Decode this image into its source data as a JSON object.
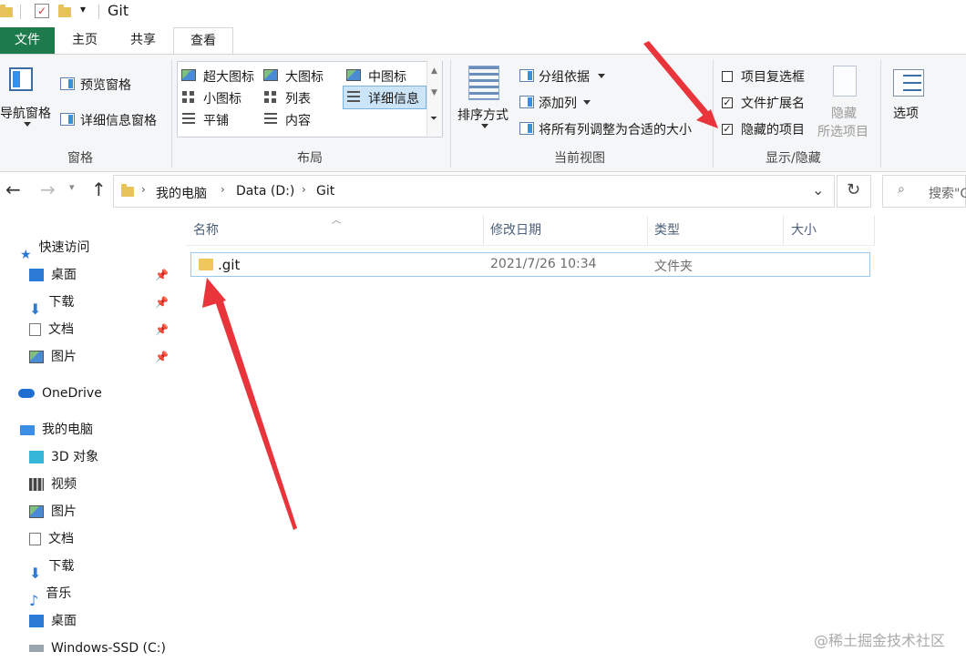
{
  "titlebar": {
    "title": "Git"
  },
  "ribbon_tabs": [
    "文件",
    "主页",
    "共享",
    "查看"
  ],
  "ribbon": {
    "panes": {
      "nav_pane": "导航窗格",
      "preview_pane": "预览窗格",
      "details_pane": "详细信息窗格",
      "group_label": "窗格"
    },
    "layout": {
      "items": [
        "超大图标",
        "大图标",
        "中图标",
        "小图标",
        "列表",
        "详细信息",
        "平铺",
        "内容"
      ],
      "group_label": "布局"
    },
    "current_view": {
      "sort_by": "排序方式",
      "group_by": "分组依据",
      "add_columns": "添加列",
      "fit_columns": "将所有列调整为合适的大小",
      "group_label": "当前视图"
    },
    "show_hide": {
      "item_checkboxes": "项目复选框",
      "file_extensions": "文件扩展名",
      "hidden_items": "隐藏的项目",
      "hide_selected_1": "隐藏",
      "hide_selected_2": "所选项目",
      "group_label": "显示/隐藏",
      "checks": {
        "item_checkboxes": false,
        "file_extensions": true,
        "hidden_items": true
      }
    },
    "options": "选项"
  },
  "address": {
    "crumbs": [
      "我的电脑",
      "Data (D:)",
      "Git"
    ],
    "search_placeholder": "搜索\"G"
  },
  "nav": {
    "quick_access": "快速访问",
    "quick": [
      "桌面",
      "下载",
      "文档",
      "图片"
    ],
    "onedrive": "OneDrive",
    "this_pc": "我的电脑",
    "pc_items": [
      "3D 对象",
      "视频",
      "图片",
      "文档",
      "下载",
      "音乐",
      "桌面",
      "Windows-SSD (C:)"
    ]
  },
  "columns": [
    "名称",
    "修改日期",
    "类型",
    "大小"
  ],
  "files": [
    {
      "name": ".git",
      "modified": "2021/7/26 10:34",
      "type": "文件夹",
      "size": ""
    }
  ],
  "watermark": "@稀土掘金技术社区",
  "colors": {
    "file_tab": "#1d7a4a",
    "arrow": "#e8343a",
    "selection": "#cce4f7"
  }
}
